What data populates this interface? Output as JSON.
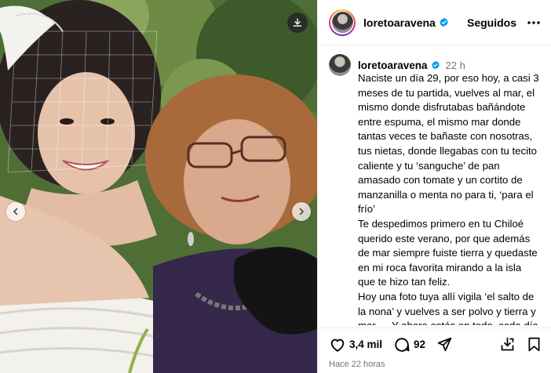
{
  "post": {
    "username": "loretoaravena",
    "follow_state": "Seguidos",
    "more_icon": "more-horizontal-icon",
    "verified_color": "#0095f6"
  },
  "caption": {
    "username": "loretoaravena",
    "time": "22 h",
    "paragraphs": [
      "Naciste un día 29, por eso hoy, a casi 3 meses de tu partida, vuelves al mar, el mismo donde disfrutabas bañándote entre espuma, el mismo mar donde tantas veces te bañaste con nosotras, tus nietas, donde llegabas con tu tecito caliente y tu ‘sanguche’ de pan amasado con tomate y un cortito de manzanilla o menta no para ti, ‘para el frío’",
      "Te despedimos primero en tu Chiloé querido este verano, por que además de mar siempre fuiste tierra y quedaste en mi roca favorita mirando a la isla que te hizo tan feliz.",
      "Hoy una foto tuya allí vigila ‘el salto de la nona’ y vuelves a ser polvo y tierra y mar…. Y ahora estás en todo, cada día en algún detalle y aunque aún espero verte en la ventana al llegar sé que desde arriba nos cuidas con tu amor"
    ]
  },
  "actions": {
    "likes": "3,4 mil",
    "comments": "92",
    "posted": "Hace 22 horas"
  },
  "media": {
    "download_icon": "download-icon",
    "prev_icon": "chevron-left-icon",
    "next_icon": "chevron-right-icon"
  }
}
